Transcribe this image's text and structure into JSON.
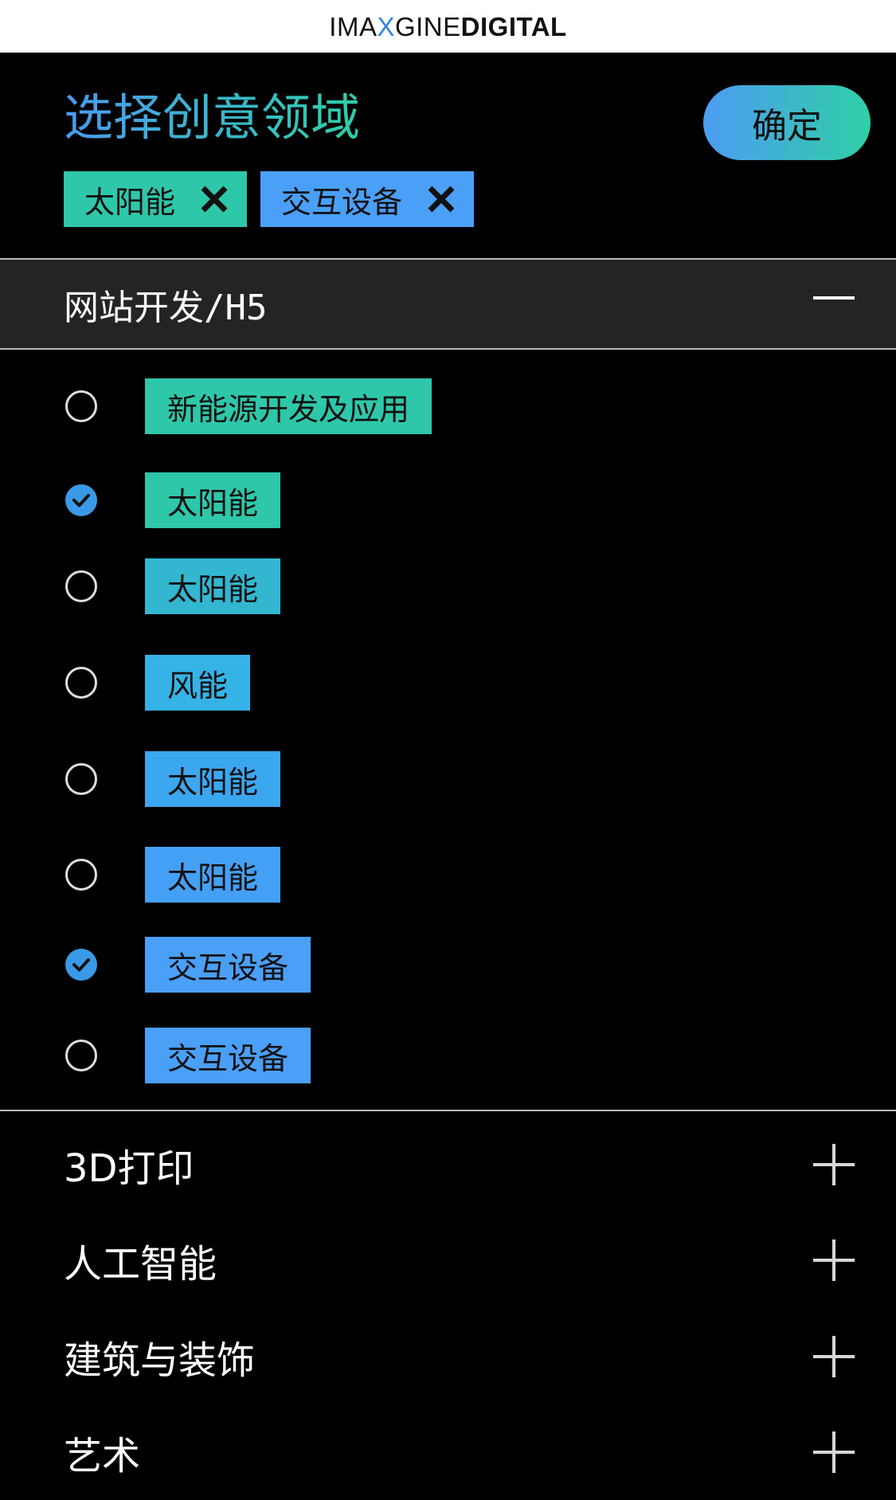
{
  "brand": {
    "part1": "IMA",
    "part2": "X",
    "part3": "GINE",
    "part4": "DIGITAL"
  },
  "header": {
    "title": "选择创意领域",
    "confirm_label": "确定"
  },
  "selected_chips": [
    {
      "label": "太阳能",
      "color": "#2ec7a9",
      "remove_icon": "close-icon"
    },
    {
      "label": "交互设备",
      "color": "#4a9ff7",
      "remove_icon": "close-icon"
    }
  ],
  "expanded_section": {
    "title": "网站开发/H5",
    "toggle_icon": "minus-icon",
    "options": [
      {
        "label": "新能源开发及应用",
        "checked": false,
        "color": "#2ec7a9"
      },
      {
        "label": "太阳能",
        "checked": true,
        "color": "#2ec7a9"
      },
      {
        "label": "太阳能",
        "checked": false,
        "color": "#33b6cf"
      },
      {
        "label": "风能",
        "checked": false,
        "color": "#35b2e6"
      },
      {
        "label": "太阳能",
        "checked": false,
        "color": "#3ba7ef"
      },
      {
        "label": "太阳能",
        "checked": false,
        "color": "#44a0f5"
      },
      {
        "label": "交互设备",
        "checked": true,
        "color": "#4a9ff7"
      },
      {
        "label": "交互设备",
        "checked": false,
        "color": "#4a9ff7"
      }
    ]
  },
  "categories": [
    {
      "label": "3D打印",
      "toggle_icon": "plus-icon"
    },
    {
      "label": "人工智能",
      "toggle_icon": "plus-icon"
    },
    {
      "label": "建筑与装饰",
      "toggle_icon": "plus-icon"
    },
    {
      "label": "艺术",
      "toggle_icon": "plus-icon"
    }
  ],
  "colors": {
    "accent_green": "#2ec7a9",
    "accent_blue": "#4a9ff7",
    "check_blue": "#3a9ae8",
    "section_bg": "#242424",
    "page_bg": "#000000"
  }
}
